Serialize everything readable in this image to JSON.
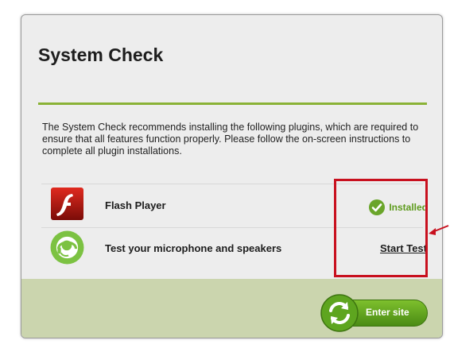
{
  "dialog": {
    "title": "System Check",
    "description": "The System Check recommends installing the following plugins, which are required to ensure that all features function properly. Please follow the on-screen instructions to complete all plugin installations."
  },
  "plugins": [
    {
      "icon": "flash-player-icon",
      "label": "Flash Player",
      "status_label": "Installed",
      "status_icon": "checkmark-icon",
      "status_color": "#5e9b1d"
    },
    {
      "icon": "microphone-headset-icon",
      "label": "Test your microphone and speakers",
      "action_label": "Start Test"
    }
  ],
  "footer": {
    "enter_label": "Enter site",
    "enter_icon": "refresh-arrows-icon"
  },
  "colors": {
    "accent": "#8ab236",
    "footer": "#cbd5ae",
    "highlight": "#c8101e"
  }
}
